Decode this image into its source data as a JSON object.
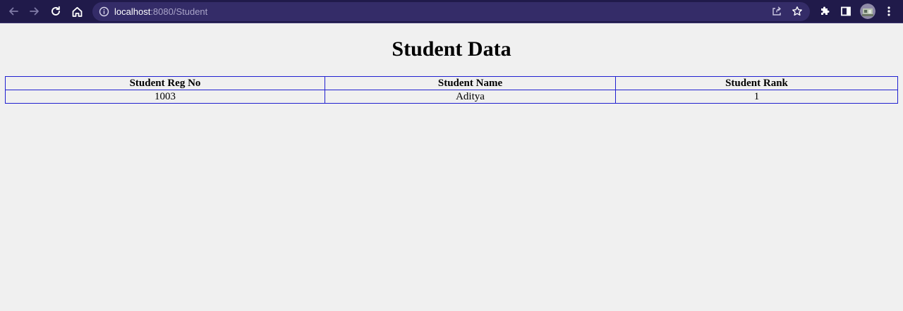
{
  "browser": {
    "url_host": "localhost",
    "url_path": ":8080/Student",
    "icons": [
      "back-arrow-icon",
      "forward-arrow-icon",
      "reload-icon",
      "home-icon",
      "info-icon",
      "share-icon",
      "star-icon",
      "extensions-puzzle-icon",
      "side-panel-icon",
      "profile-avatar",
      "more-menu-icon"
    ]
  },
  "page": {
    "title": "Student Data",
    "table": {
      "headers": [
        "Student Reg No",
        "Student Name",
        "Student Rank"
      ],
      "rows": [
        [
          "1003",
          "Aditya",
          "1"
        ]
      ]
    }
  },
  "colors": {
    "toolbar_bg": "#201a4a",
    "omnibox_bg": "#342c68",
    "table_border": "#2020d0",
    "page_bg": "#f0f0f0"
  }
}
